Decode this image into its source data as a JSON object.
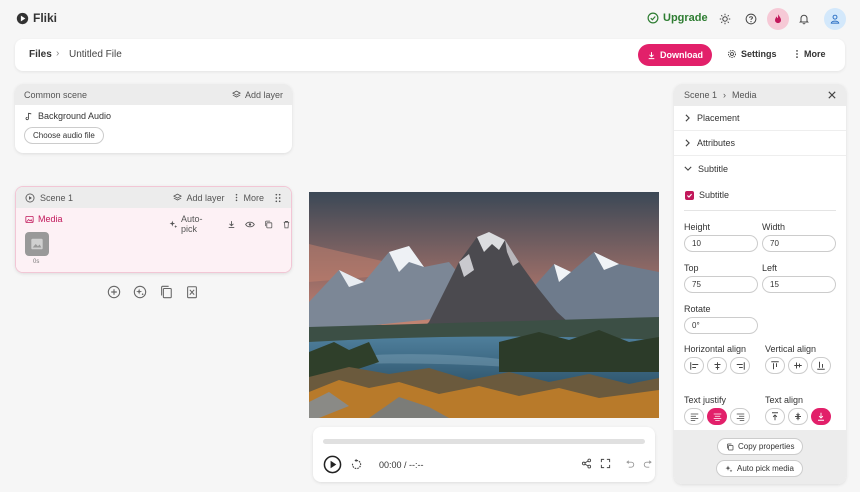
{
  "app": {
    "name": "Fliki",
    "upgrade_label": "Upgrade"
  },
  "filebar": {
    "files": "Files",
    "separator": "›",
    "file_name": "Untitled File",
    "download_label": "Download",
    "settings_label": "Settings",
    "more_label": "More"
  },
  "common_scene": {
    "title": "Common scene",
    "add_layer_label": "Add layer",
    "audio_label": "Background Audio",
    "choose_audio_label": "Choose audio file"
  },
  "scene1": {
    "title": "Scene 1",
    "add_layer_label": "Add layer",
    "more_label": "More",
    "media_label": "Media",
    "autopick_label": "Auto-pick",
    "thumb_duration": "0s"
  },
  "player": {
    "time": "00:00 / --:--",
    "progress": 0
  },
  "right_panel": {
    "breadcrumb_scene": "Scene 1",
    "separator": "›",
    "breadcrumb_media": "Media",
    "sections": {
      "placement": "Placement",
      "attributes": "Attributes",
      "subtitle": "Subtitle"
    },
    "subtitle_checkbox_label": "Subtitle",
    "subtitle_checked": true,
    "height_label": "Height",
    "height_value": "10",
    "width_label": "Width",
    "width_value": "70",
    "top_label": "Top",
    "top_value": "75",
    "left_label": "Left",
    "left_value": "15",
    "rotate_label": "Rotate",
    "rotate_value": "0°",
    "halign_label": "Horizontal align",
    "valign_label": "Vertical align",
    "tjustify_label": "Text justify",
    "talign_label": "Text align",
    "copy_label": "Copy properties",
    "autopick_label": "Auto pick media"
  },
  "colors": {
    "accent": "#e2206a",
    "upgrade": "#2e7d32"
  }
}
